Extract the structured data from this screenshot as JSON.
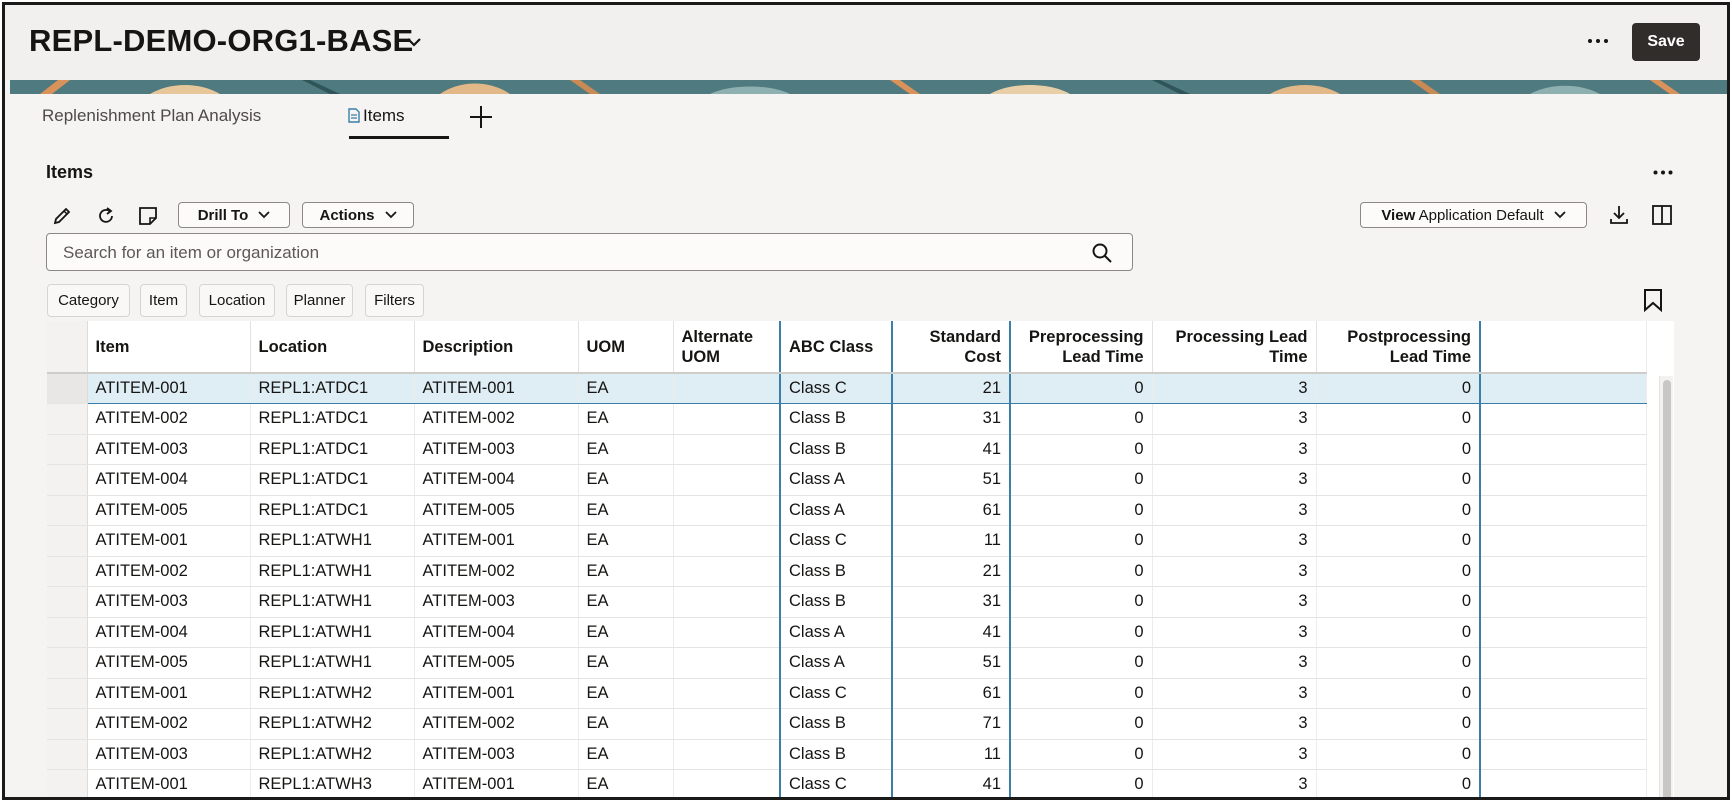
{
  "header": {
    "title": "REPL-DEMO-ORG1-BASE",
    "save_label": "Save"
  },
  "tabs": [
    {
      "label": "Replenishment Plan Analysis"
    },
    {
      "label": "Items"
    }
  ],
  "section": {
    "title": "Items"
  },
  "toolbar": {
    "drill_to": "Drill To",
    "actions": "Actions",
    "view_prefix": "View",
    "view_value": "Application Default"
  },
  "search": {
    "placeholder": "Search for an item or organization"
  },
  "filters": [
    "Category",
    "Item",
    "Location",
    "Planner",
    "Filters"
  ],
  "table": {
    "headers": {
      "item": "Item",
      "location": "Location",
      "description": "Description",
      "uom": "UOM",
      "alt_uom": "Alternate UOM",
      "abc": "ABC Class",
      "cost": "Standard Cost",
      "pre": "Preprocessing Lead Time",
      "proc": "Processing Lead Time",
      "post": "Postprocessing Lead Time"
    },
    "rows": [
      [
        "ATITEM-001",
        "REPL1:ATDC1",
        "ATITEM-001",
        "EA",
        "",
        "Class C",
        "21",
        "0",
        "3",
        "0"
      ],
      [
        "ATITEM-002",
        "REPL1:ATDC1",
        "ATITEM-002",
        "EA",
        "",
        "Class B",
        "31",
        "0",
        "3",
        "0"
      ],
      [
        "ATITEM-003",
        "REPL1:ATDC1",
        "ATITEM-003",
        "EA",
        "",
        "Class B",
        "41",
        "0",
        "3",
        "0"
      ],
      [
        "ATITEM-004",
        "REPL1:ATDC1",
        "ATITEM-004",
        "EA",
        "",
        "Class A",
        "51",
        "0",
        "3",
        "0"
      ],
      [
        "ATITEM-005",
        "REPL1:ATDC1",
        "ATITEM-005",
        "EA",
        "",
        "Class A",
        "61",
        "0",
        "3",
        "0"
      ],
      [
        "ATITEM-001",
        "REPL1:ATWH1",
        "ATITEM-001",
        "EA",
        "",
        "Class C",
        "11",
        "0",
        "3",
        "0"
      ],
      [
        "ATITEM-002",
        "REPL1:ATWH1",
        "ATITEM-002",
        "EA",
        "",
        "Class B",
        "21",
        "0",
        "3",
        "0"
      ],
      [
        "ATITEM-003",
        "REPL1:ATWH1",
        "ATITEM-003",
        "EA",
        "",
        "Class B",
        "31",
        "0",
        "3",
        "0"
      ],
      [
        "ATITEM-004",
        "REPL1:ATWH1",
        "ATITEM-004",
        "EA",
        "",
        "Class A",
        "41",
        "0",
        "3",
        "0"
      ],
      [
        "ATITEM-005",
        "REPL1:ATWH1",
        "ATITEM-005",
        "EA",
        "",
        "Class A",
        "51",
        "0",
        "3",
        "0"
      ],
      [
        "ATITEM-001",
        "REPL1:ATWH2",
        "ATITEM-001",
        "EA",
        "",
        "Class C",
        "61",
        "0",
        "3",
        "0"
      ],
      [
        "ATITEM-002",
        "REPL1:ATWH2",
        "ATITEM-002",
        "EA",
        "",
        "Class B",
        "71",
        "0",
        "3",
        "0"
      ],
      [
        "ATITEM-003",
        "REPL1:ATWH2",
        "ATITEM-003",
        "EA",
        "",
        "Class B",
        "11",
        "0",
        "3",
        "0"
      ],
      [
        "ATITEM-001",
        "REPL1:ATWH3",
        "ATITEM-001",
        "EA",
        "",
        "Class C",
        "41",
        "0",
        "3",
        "0"
      ]
    ]
  }
}
